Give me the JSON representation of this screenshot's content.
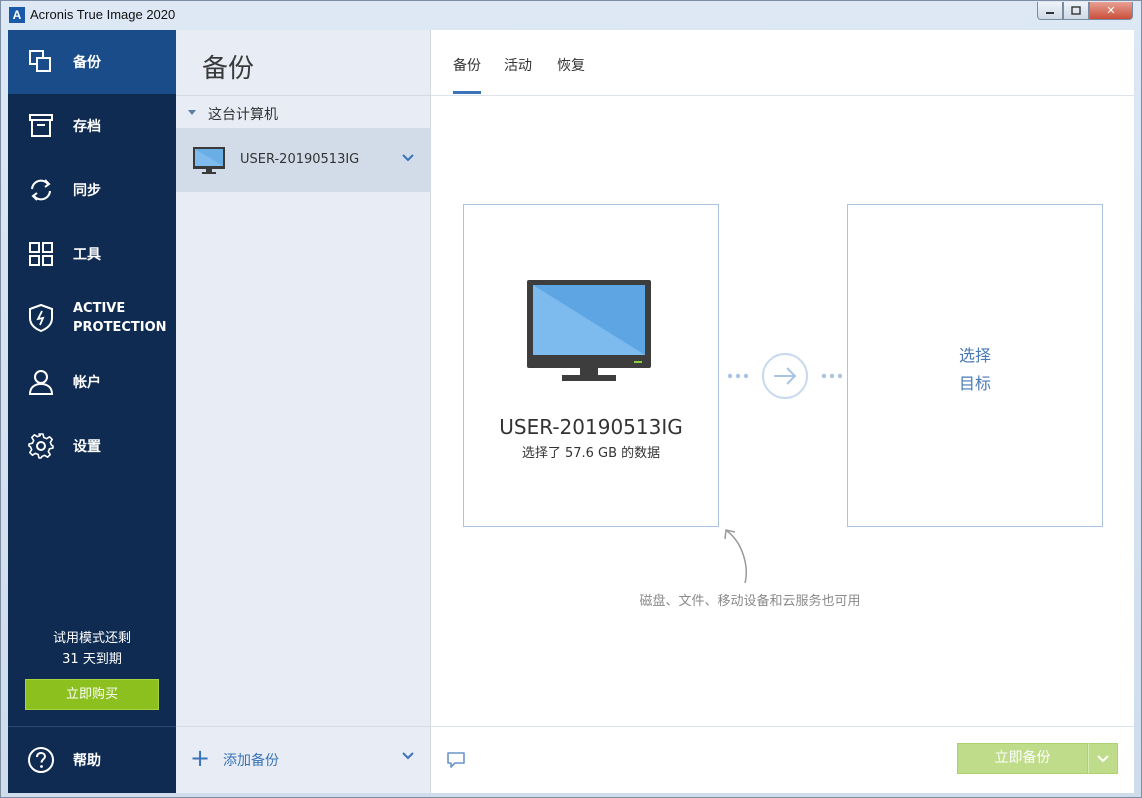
{
  "window": {
    "title": "Acronis True Image 2020",
    "app_icon_letter": "A"
  },
  "nav": {
    "items": [
      {
        "id": "backup",
        "label": "备份",
        "icon": "copy-icon",
        "active": true
      },
      {
        "id": "archive",
        "label": "存档",
        "icon": "archive-box-icon"
      },
      {
        "id": "sync",
        "label": "同步",
        "icon": "sync-icon"
      },
      {
        "id": "tools",
        "label": "工具",
        "icon": "grid-icon"
      },
      {
        "id": "active-protection",
        "label_line1": "ACTIVE",
        "label_line2": "PROTECTION",
        "icon": "shield-icon"
      },
      {
        "id": "account",
        "label": "帐户",
        "icon": "user-icon"
      },
      {
        "id": "settings",
        "label": "设置",
        "icon": "gear-icon"
      }
    ],
    "trial_line1": "试用模式还剩",
    "trial_line2": "31 天到期",
    "buy_label": "立即购买",
    "help_label": "帮助"
  },
  "sidebar": {
    "title": "备份",
    "group_label": "这台计算机",
    "machine_name": "USER-20190513IG",
    "add_backup_label": "添加备份"
  },
  "tabs": [
    {
      "label": "备份",
      "active": true
    },
    {
      "label": "活动"
    },
    {
      "label": "恢复"
    }
  ],
  "source": {
    "name": "USER-20190513IG",
    "info": "选择了 57.6 GB 的数据"
  },
  "destination": {
    "line1": "选择",
    "line2": "目标"
  },
  "hint": "磁盘、文件、移动设备和云服务也可用",
  "footer": {
    "backup_now_label": "立即备份"
  },
  "colors": {
    "nav_bg": "#0f2b52",
    "nav_active": "#1b4c8a",
    "accent": "#3a73b8",
    "buy_green": "#8cc01f",
    "backup_green_disabled": "#bfdc8a"
  }
}
